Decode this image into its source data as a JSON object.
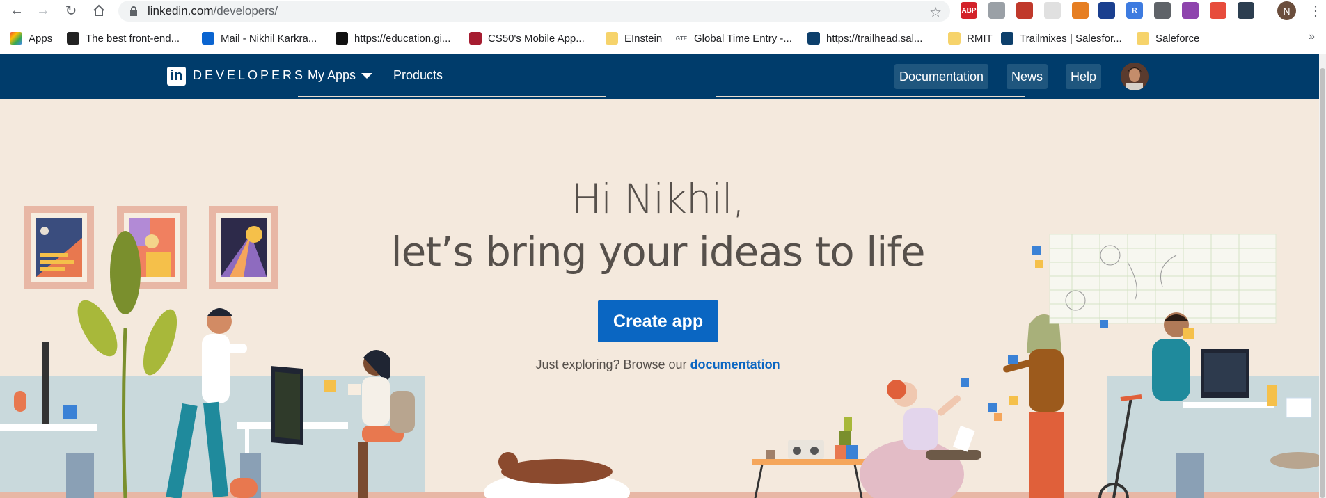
{
  "browser": {
    "url_host": "linkedin.com",
    "url_path": "/developers/",
    "profile_initial": "N",
    "extensions": [
      {
        "name": "adblock-plus-icon",
        "label": "ABP",
        "color": "#d3222a"
      },
      {
        "name": "camera-icon",
        "label": "",
        "color": "#9aa0a6"
      },
      {
        "name": "pdf-icon",
        "label": "",
        "color": "#c0392b"
      },
      {
        "name": "blank-ext-icon",
        "label": "",
        "color": "#e0e0e0"
      },
      {
        "name": "image-ext-icon",
        "label": "",
        "color": "#e67e22"
      },
      {
        "name": "monitor-ext-icon",
        "label": "",
        "color": "#1a3f8f"
      },
      {
        "name": "r-ext-icon",
        "label": "R",
        "color": "#3d7be0"
      },
      {
        "name": "code-ext-icon",
        "label": "",
        "color": "#5f6368"
      },
      {
        "name": "pie-ext-icon",
        "label": "",
        "color": "#8e44ad"
      },
      {
        "name": "svelte-ext-icon",
        "label": "",
        "color": "#e74c3c"
      },
      {
        "name": "puzzle-ext-icon",
        "label": "",
        "color": "#2c3e50"
      }
    ]
  },
  "bookmarks": [
    {
      "label": "Apps",
      "icon": "apps-grid-icon",
      "color": "#4285f4"
    },
    {
      "label": "The best front-end...",
      "icon": "frontend-icon",
      "color": "#222222"
    },
    {
      "label": "Mail - Nikhil Karkra...",
      "icon": "outlook-icon",
      "color": "#0a64d0"
    },
    {
      "label": "https://education.gi...",
      "icon": "github-icon",
      "color": "#111111"
    },
    {
      "label": "CS50's Mobile App...",
      "icon": "harvard-icon",
      "color": "#a51c30"
    },
    {
      "label": "EInstein",
      "icon": "folder-icon",
      "color": "#f6d36b"
    },
    {
      "label": "Global Time Entry -...",
      "icon": "gte-icon",
      "color": "#ffffff"
    },
    {
      "label": "https://trailhead.sal...",
      "icon": "trailhead-icon",
      "color": "#0d3f6b"
    },
    {
      "label": "RMIT",
      "icon": "folder-icon",
      "color": "#f6d36b"
    },
    {
      "label": "Trailmixes | Salesfor...",
      "icon": "trailhead-icon",
      "color": "#0d3f6b"
    },
    {
      "label": "Saleforce",
      "icon": "folder-icon",
      "color": "#f6d36b"
    }
  ],
  "nav": {
    "brand": "DEVELOPERS",
    "my_apps": "My Apps",
    "products": "Products",
    "documentation": "Documentation",
    "news": "News",
    "help": "Help"
  },
  "hero": {
    "greeting": "Hi Nikhil,",
    "tagline": "let’s bring your ideas to life",
    "cta": "Create app",
    "explore_prefix": "Just exploring? Browse our",
    "explore_link": "documentation"
  },
  "colors": {
    "nav_bg": "#003c6b",
    "hero_bg": "#f4e9dd",
    "cta": "#0a66c2"
  }
}
